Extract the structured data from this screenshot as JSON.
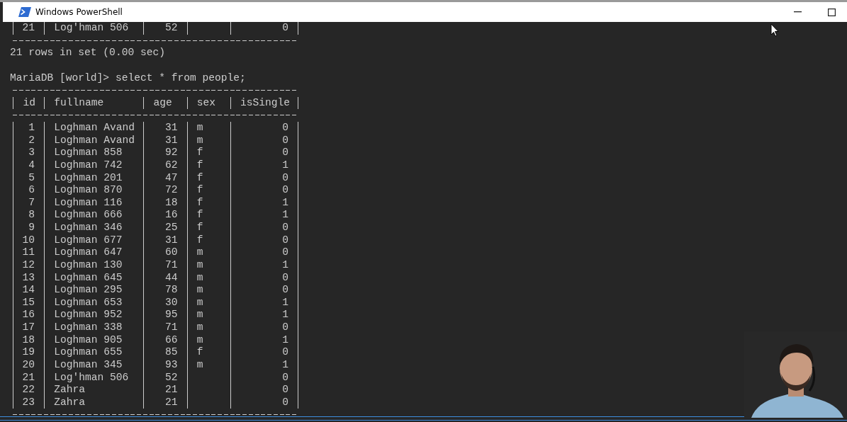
{
  "window": {
    "title": "Windows PowerShell"
  },
  "previous_result": {
    "last_row": {
      "id": "21",
      "fullname": "Log'hman 506",
      "age": "52",
      "isSingle": "0"
    },
    "footer": "21 rows in set (0.00 sec)"
  },
  "prompt": "MariaDB [world]> select * from people;",
  "table": {
    "columns": [
      "id",
      "fullname",
      "age",
      "sex",
      "isSingle"
    ],
    "rows": [
      {
        "id": "1",
        "fullname": "Loghman Avand",
        "age": "31",
        "sex": "m",
        "isSingle": "0"
      },
      {
        "id": "2",
        "fullname": "Loghman Avand",
        "age": "31",
        "sex": "m",
        "isSingle": "0"
      },
      {
        "id": "3",
        "fullname": "Loghman 858",
        "age": "92",
        "sex": "f",
        "isSingle": "0"
      },
      {
        "id": "4",
        "fullname": "Loghman 742",
        "age": "62",
        "sex": "f",
        "isSingle": "1"
      },
      {
        "id": "5",
        "fullname": "Loghman 201",
        "age": "47",
        "sex": "f",
        "isSingle": "0"
      },
      {
        "id": "6",
        "fullname": "Loghman 870",
        "age": "72",
        "sex": "f",
        "isSingle": "0"
      },
      {
        "id": "7",
        "fullname": "Loghman 116",
        "age": "18",
        "sex": "f",
        "isSingle": "1"
      },
      {
        "id": "8",
        "fullname": "Loghman 666",
        "age": "16",
        "sex": "f",
        "isSingle": "1"
      },
      {
        "id": "9",
        "fullname": "Loghman 346",
        "age": "25",
        "sex": "f",
        "isSingle": "0"
      },
      {
        "id": "10",
        "fullname": "Loghman 677",
        "age": "31",
        "sex": "f",
        "isSingle": "0"
      },
      {
        "id": "11",
        "fullname": "Loghman 647",
        "age": "60",
        "sex": "m",
        "isSingle": "0"
      },
      {
        "id": "12",
        "fullname": "Loghman 130",
        "age": "71",
        "sex": "m",
        "isSingle": "1"
      },
      {
        "id": "13",
        "fullname": "Loghman 645",
        "age": "44",
        "sex": "m",
        "isSingle": "0"
      },
      {
        "id": "14",
        "fullname": "Loghman 295",
        "age": "78",
        "sex": "m",
        "isSingle": "0"
      },
      {
        "id": "15",
        "fullname": "Loghman 653",
        "age": "30",
        "sex": "m",
        "isSingle": "1"
      },
      {
        "id": "16",
        "fullname": "Loghman 952",
        "age": "95",
        "sex": "m",
        "isSingle": "1"
      },
      {
        "id": "17",
        "fullname": "Loghman 338",
        "age": "71",
        "sex": "m",
        "isSingle": "0"
      },
      {
        "id": "18",
        "fullname": "Loghman 905",
        "age": "66",
        "sex": "m",
        "isSingle": "1"
      },
      {
        "id": "19",
        "fullname": "Loghman 655",
        "age": "85",
        "sex": "f",
        "isSingle": "0"
      },
      {
        "id": "20",
        "fullname": "Loghman 345",
        "age": "93",
        "sex": "m",
        "isSingle": "1"
      },
      {
        "id": "21",
        "fullname": "Log'hman 506",
        "age": "52",
        "isSingle": "0"
      },
      {
        "id": "22",
        "fullname": "Zahra",
        "age": "21",
        "isSingle": "0"
      },
      {
        "id": "23",
        "fullname": "Zahra",
        "age": "21",
        "isSingle": "0"
      }
    ]
  }
}
